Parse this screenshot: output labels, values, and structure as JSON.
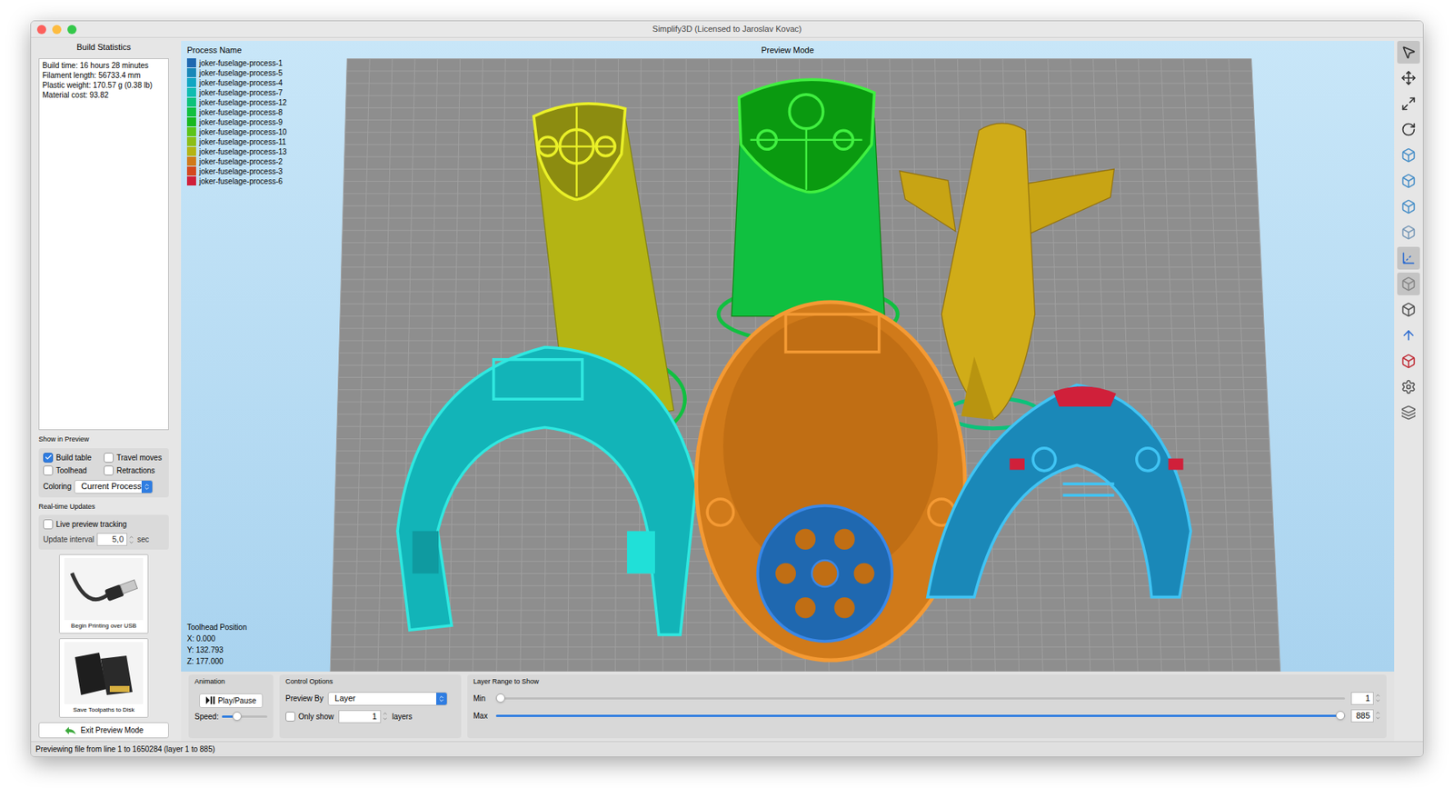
{
  "window": {
    "title": "Simplify3D (Licensed to Jaroslav Kovac)"
  },
  "build_statistics": {
    "title": "Build Statistics",
    "lines": [
      "Build time: 16 hours 28 minutes",
      "Filament length: 56733.4 mm",
      "Plastic weight: 170.57 g (0.38 lb)",
      "Material cost: 93.82"
    ]
  },
  "show_in_preview": {
    "title": "Show in Preview",
    "options": [
      {
        "label": "Build table",
        "checked": true
      },
      {
        "label": "Travel moves",
        "checked": false
      },
      {
        "label": "Toolhead",
        "checked": false
      },
      {
        "label": "Retractions",
        "checked": false
      }
    ],
    "coloring_label": "Coloring",
    "coloring_value": "Current Process"
  },
  "realtime": {
    "title": "Real-time Updates",
    "live_tracking": {
      "label": "Live preview tracking",
      "checked": false
    },
    "interval_label": "Update interval",
    "interval_value": "5,0",
    "interval_unit": "sec"
  },
  "output_buttons": [
    {
      "label": "Begin Printing over USB",
      "kind": "usb"
    },
    {
      "label": "Save Toolpaths to Disk",
      "kind": "sd"
    }
  ],
  "exit_button": "Exit Preview Mode",
  "viewport": {
    "title": "Preview Mode",
    "legend_title": "Process Name",
    "legend": [
      {
        "label": "joker-fuselage-process-1",
        "color": "#1f68b0"
      },
      {
        "label": "joker-fuselage-process-5",
        "color": "#1a88b8"
      },
      {
        "label": "joker-fuselage-process-4",
        "color": "#12a6c2"
      },
      {
        "label": "joker-fuselage-process-7",
        "color": "#10bcb0"
      },
      {
        "label": "joker-fuselage-process-12",
        "color": "#0cc27a"
      },
      {
        "label": "joker-fuselage-process-8",
        "color": "#10c040"
      },
      {
        "label": "joker-fuselage-process-9",
        "color": "#18b820"
      },
      {
        "label": "joker-fuselage-process-10",
        "color": "#5cc41a"
      },
      {
        "label": "joker-fuselage-process-11",
        "color": "#8cbe18"
      },
      {
        "label": "joker-fuselage-process-13",
        "color": "#b4b414"
      },
      {
        "label": "joker-fuselage-process-2",
        "color": "#d07a1a"
      },
      {
        "label": "joker-fuselage-process-3",
        "color": "#d4481e"
      },
      {
        "label": "joker-fuselage-process-6",
        "color": "#d0203a"
      }
    ],
    "toolhead": {
      "title": "Toolhead Position",
      "x": "X: 0.000",
      "y": "Y: 132.793",
      "z": "Z: 177.000"
    }
  },
  "toolbar": [
    {
      "selected": true
    },
    {
      "selected": false
    },
    {
      "selected": false
    },
    {
      "selected": false
    },
    {
      "selected": false
    },
    {
      "selected": false
    },
    {
      "selected": false
    },
    {
      "selected": false
    },
    {
      "selected": true
    },
    {
      "selected": true
    },
    {
      "selected": false
    },
    {
      "selected": false
    },
    {
      "selected": false
    },
    {
      "selected": false
    },
    {
      "selected": false
    }
  ],
  "animation": {
    "title": "Animation",
    "play_label": "Play/Pause",
    "speed_label": "Speed:",
    "speed_level": 0.3
  },
  "control_options": {
    "title": "Control Options",
    "preview_by_label": "Preview By",
    "preview_by_value": "Layer",
    "only_show": {
      "label": "Only show",
      "checked": false
    },
    "layers_value": "1",
    "layers_unit": "layers"
  },
  "layer_range": {
    "title": "Layer Range to Show",
    "min": {
      "label": "Min",
      "value": "1",
      "level": 0
    },
    "max": {
      "label": "Max",
      "value": "885",
      "level": 1
    }
  },
  "status_bar": "Previewing file from line 1 to 1650284 (layer 1 to 885)"
}
